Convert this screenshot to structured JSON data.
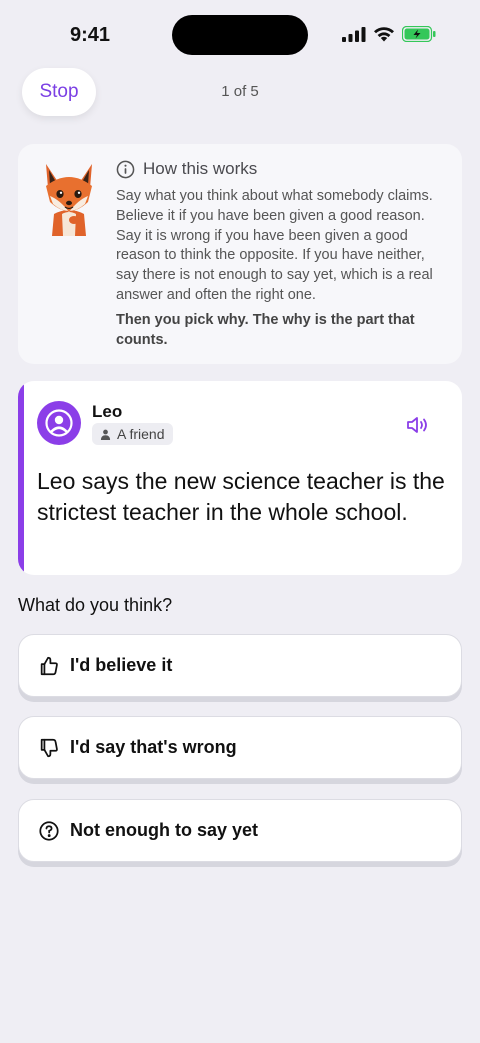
{
  "status_bar": {
    "time": "9:41"
  },
  "top_bar": {
    "stop_label": "Stop",
    "progress": "1 of 5"
  },
  "how_it_works": {
    "title": "How this works",
    "body": "Say what you think about what somebody claims. Believe it if you have been given a good reason. Say it is wrong if you have been given a good reason to think the opposite. If you have neither, say there is not enough to say yet, which is a real answer and often the right one.",
    "emphasis": "Then you pick why. The why is the part that counts."
  },
  "claim": {
    "speaker": "Leo",
    "relation": "A friend",
    "text": "Leo says the new science teacher is the strictest teacher in the whole school."
  },
  "question": "What do you think?",
  "answers": [
    {
      "label": "I'd believe it",
      "icon": "thumbs-up-icon"
    },
    {
      "label": "I'd say that's wrong",
      "icon": "thumbs-down-icon"
    },
    {
      "label": "Not enough to say yet",
      "icon": "question-circle-icon"
    }
  ],
  "colors": {
    "accent": "#8b3ee8",
    "background": "#efeef4",
    "card": "#ffffff"
  }
}
